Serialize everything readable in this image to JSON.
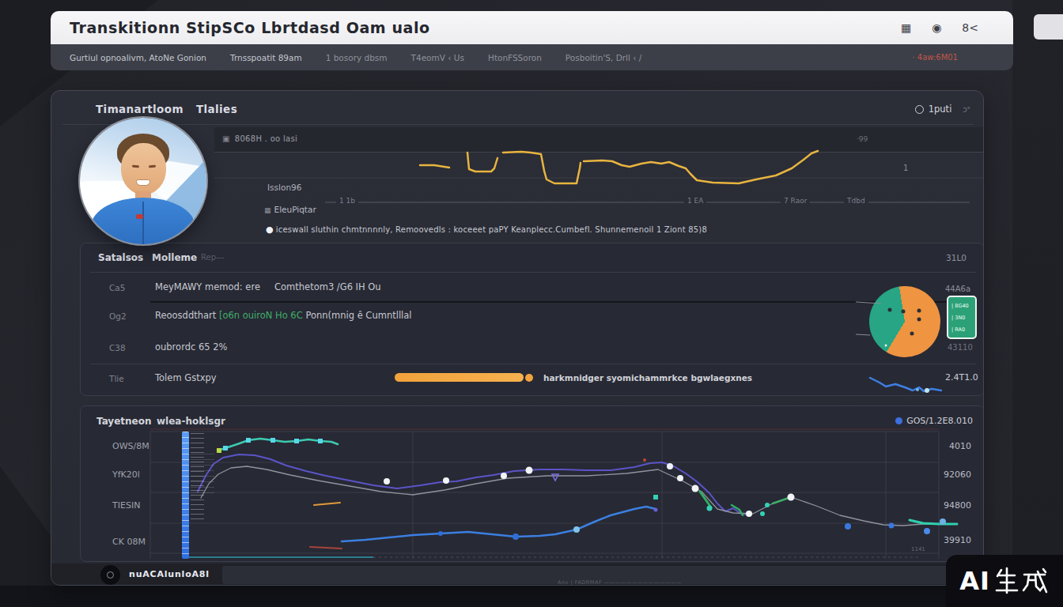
{
  "window": {
    "title": "Transkitionn  StipSCo  Lbrtdasd  Oam ualo",
    "titlebar_icons": [
      "grid-icon",
      "globe-icon",
      "user-icon"
    ],
    "nav": {
      "items": [
        "Gurtiul opnoalivm, AtoNe Gonion",
        "Trnsspoatit 89am",
        "1 bosory dbsm",
        "T4eomV ‹ Us",
        "HtonFSSoron",
        "Posboitin'S, Drll ‹ /"
      ],
      "right_badge": "· 4aw:6M01"
    }
  },
  "panel": {
    "title_word1": "Timanartloom",
    "title_word2": "Tlalies",
    "pub_label": "1puti",
    "pub_extra": "ɔᵊ",
    "meta_label": "8068H . oo lasi",
    "meta_right": "·99",
    "axis_mark": "1",
    "label_primary": "Isslon96",
    "label_secondary": "EleuPiqtar",
    "ticks": [
      "1 1b",
      "1 EA",
      "7 Raor",
      "Tdbd"
    ],
    "note_bullet": "●",
    "note": "iceswall sluthin chmtnnnnly, Remoovedls : koceeet paPY Keanplecc.Cumbefl. Shunnemenoil 1 Ziont 85)8"
  },
  "overview": {
    "col1": "Satalsos",
    "col2": "Molleme",
    "col2_faded": "Rep---",
    "header_value": "31L0",
    "rows": [
      {
        "label": "Ca5",
        "text1": "MeyMAWY memod: ere",
        "text2": "Comthetom3 /G6 IH Ou",
        "value": "44A6a"
      },
      {
        "label": "Og2",
        "text1": "Reoosddthart ",
        "green": "[o6n ouiroN Ho 6C ",
        "text2": "Ponn(mnig ê Cumntlllal"
      },
      {
        "label": "C38",
        "text1": "oubrordc 65 2%"
      },
      {
        "label": "Tlie",
        "text1": "Tolem Gstxpy",
        "note": "harkmnidger syomichammrkce bgwlaegxnes"
      }
    ],
    "legend_lines": [
      "| 8G40",
      "| 3N0",
      "| RA0"
    ],
    "legend_footer": "43110",
    "spark_value": "2.4T1.0"
  },
  "lower": {
    "title_word1": "Tayetneon",
    "title_word2": "wlea-hoklsgr",
    "right_value": "GOS/1.2E8.010",
    "y_labels": [
      "OWS/8M",
      "YfK20l",
      "TIESIN",
      "CK 08M"
    ],
    "right_values": [
      "4010",
      "92060",
      "94800",
      "39910"
    ],
    "corner_note": "1141"
  },
  "footer": {
    "button_label": "nuACAlunloA8l",
    "fineprint": "Anv | FADRMAF ——————————————"
  },
  "watermark": {
    "label": "AI生成",
    "latin": "AI"
  },
  "chart_data": {
    "yellow_spark": {
      "type": "line",
      "series": [
        {
          "color": "#e7b43f",
          "width": 2.5,
          "points": [
            [
              260,
              48
            ],
            [
              278,
              48
            ],
            [
              297,
              51
            ]
          ]
        },
        {
          "color": "#e7b43f",
          "width": 2.5,
          "points": [
            [
              320,
              32
            ],
            [
              322,
              53
            ],
            [
              330,
              56
            ],
            [
              350,
              56
            ],
            [
              354,
              52
            ],
            [
              358,
              39
            ]
          ]
        },
        {
          "color": "#e7b43f",
          "width": 2.5,
          "points": [
            [
              365,
              32
            ],
            [
              388,
              31
            ],
            [
              400,
              32
            ],
            [
              413,
              34
            ],
            [
              417,
              55
            ],
            [
              420,
              66
            ],
            [
              430,
              71
            ],
            [
              458,
              71
            ],
            [
              462,
              52
            ],
            [
              463,
              45
            ]
          ]
        },
        {
          "color": "#e7b43f",
          "width": 2.5,
          "points": [
            [
              467,
              43
            ],
            [
              490,
              42
            ],
            [
              503,
              43
            ],
            [
              515,
              48
            ],
            [
              525,
              50
            ],
            [
              540,
              46
            ],
            [
              552,
              44
            ],
            [
              565,
              46
            ],
            [
              575,
              44
            ],
            [
              587,
              49
            ],
            [
              596,
              52
            ],
            [
              602,
              59
            ],
            [
              610,
              67
            ],
            [
              630,
              70
            ],
            [
              663,
              71
            ],
            [
              685,
              66
            ],
            [
              710,
              61
            ],
            [
              730,
              52
            ],
            [
              745,
              41
            ],
            [
              755,
              33
            ],
            [
              763,
              30
            ]
          ]
        }
      ]
    },
    "pie": {
      "type": "pie",
      "slices": [
        {
          "color": "#27a584",
          "pct": 39
        },
        {
          "color": "#ef9440",
          "pct": 61
        }
      ],
      "teal_deg": [
        211,
        351
      ],
      "dots": [
        [
          1023,
          84,
          2.5,
          "#2c2e35"
        ],
        [
          1040,
          86,
          2.5,
          "#2c2e35"
        ],
        [
          1060,
          85,
          2.5,
          "#2c2e35"
        ],
        [
          1060,
          96,
          2.5,
          "#2c2e35"
        ],
        [
          1051,
          114,
          2.5,
          "#2c2e35"
        ],
        [
          1018,
          129,
          1.5,
          "#e8f4ee"
        ]
      ]
    },
    "blue_spark": {
      "type": "line",
      "series": [
        {
          "color": "#3e7ee2",
          "width": 2.5,
          "points": [
            [
              998,
              170
            ],
            [
              1010,
              176
            ],
            [
              1018,
              181
            ],
            [
              1030,
              178
            ],
            [
              1042,
              182
            ],
            [
              1052,
              186
            ],
            [
              1060,
              182
            ],
            [
              1066,
              187
            ],
            [
              1076,
              184
            ],
            [
              1088,
              186
            ]
          ]
        }
      ],
      "dots": [
        [
          1070,
          186,
          3,
          "#bfe3f2"
        ],
        [
          1058,
          185,
          2,
          "#6fb7e8"
        ]
      ]
    },
    "lower_multi": {
      "type": "line",
      "series": [
        {
          "name": "teal",
          "color": "#3ec9b0",
          "width": 2.5,
          "points": [
            [
              173,
              56
            ],
            [
              183,
              53
            ],
            [
              198,
              48
            ],
            [
              212,
              43
            ],
            [
              227,
              41
            ],
            [
              243,
              43
            ],
            [
              258,
              45
            ],
            [
              273,
              44
            ],
            [
              288,
              42
            ],
            [
              303,
              44
            ],
            [
              317,
              45
            ],
            [
              325,
              48
            ]
          ]
        },
        {
          "name": "purple",
          "color": "#5b54c8",
          "width": 2,
          "points": [
            [
              148,
              108
            ],
            [
              158,
              88
            ],
            [
              168,
              73
            ],
            [
              180,
              65
            ],
            [
              200,
              61
            ],
            [
              220,
              62
            ],
            [
              240,
              67
            ],
            [
              260,
              75
            ],
            [
              285,
              82
            ],
            [
              310,
              88
            ],
            [
              340,
              94
            ],
            [
              370,
              100
            ],
            [
              400,
              104
            ],
            [
              430,
              100
            ],
            [
              455,
              96
            ],
            [
              475,
              95
            ],
            [
              500,
              90
            ],
            [
              522,
              87
            ],
            [
              548,
              82
            ],
            [
              580,
              80
            ],
            [
              610,
              80
            ],
            [
              640,
              81
            ],
            [
              670,
              81
            ],
            [
              700,
              77
            ],
            [
              720,
              72
            ],
            [
              735,
              71
            ],
            [
              750,
              76
            ],
            [
              765,
              85
            ],
            [
              780,
              96
            ],
            [
              795,
              110
            ],
            [
              805,
              123
            ],
            [
              815,
              133
            ],
            [
              825,
              129
            ],
            [
              835,
              136
            ],
            [
              845,
              137
            ]
          ]
        },
        {
          "name": "gray",
          "color": "#8f949e",
          "width": 1.3,
          "points": [
            [
              152,
              116
            ],
            [
              162,
              98
            ],
            [
              174,
              86
            ],
            [
              190,
              78
            ],
            [
              210,
              76
            ],
            [
              235,
              80
            ],
            [
              265,
              87
            ],
            [
              300,
              94
            ],
            [
              340,
              101
            ],
            [
              380,
              108
            ],
            [
              420,
              112
            ],
            [
              460,
              106
            ],
            [
              500,
              98
            ],
            [
              540,
              91
            ],
            [
              590,
              88
            ],
            [
              640,
              88
            ],
            [
              690,
              85
            ],
            [
              730,
              80
            ],
            [
              760,
              94
            ],
            [
              785,
              108
            ],
            [
              805,
              130
            ],
            [
              825,
              135
            ],
            [
              850,
              136
            ],
            [
              875,
              123
            ],
            [
              898,
              115
            ],
            [
              930,
              126
            ],
            [
              960,
              138
            ],
            [
              990,
              145
            ],
            [
              1015,
              150
            ],
            [
              1040,
              151
            ],
            [
              1065,
              149
            ],
            [
              1085,
              149
            ]
          ]
        },
        {
          "name": "blue",
          "color": "#3b7fe0",
          "width": 2.5,
          "points": [
            [
              330,
              171
            ],
            [
              360,
              169
            ],
            [
              390,
              166
            ],
            [
              420,
              163
            ],
            [
              455,
              161
            ],
            [
              490,
              159
            ],
            [
              520,
              162
            ],
            [
              550,
              165
            ],
            [
              580,
              164
            ],
            [
              600,
              162
            ],
            [
              627,
              156
            ],
            [
              650,
              146
            ],
            [
              670,
              138
            ],
            [
              700,
              130
            ],
            [
              715,
              127
            ],
            [
              727,
              130
            ]
          ]
        },
        {
          "name": "teal-end",
          "color": "#2fd0b0",
          "width": 3,
          "points": [
            [
              1048,
              144
            ],
            [
              1065,
              148
            ],
            [
              1085,
              149
            ],
            [
              1108,
              149
            ]
          ]
        },
        {
          "name": "green-a",
          "color": "#2fae62",
          "width": 3,
          "points": [
            [
              783,
              108
            ],
            [
              797,
              128
            ]
          ]
        },
        {
          "name": "green-b",
          "color": "#2fae62",
          "width": 2.5,
          "points": [
            [
              823,
              125
            ],
            [
              833,
              131
            ],
            [
              837,
              138
            ]
          ]
        },
        {
          "name": "green-c",
          "color": "#3fae6a",
          "width": 2.5,
          "points": [
            [
              875,
              123
            ],
            [
              898,
              115
            ]
          ]
        },
        {
          "name": "orange",
          "color": "#e09a3a",
          "width": 2,
          "points": [
            [
              295,
              125
            ],
            [
              328,
              122
            ]
          ]
        },
        {
          "name": "red",
          "color": "#a5443c",
          "width": 2,
          "points": [
            [
              290,
              178
            ],
            [
              330,
              180
            ]
          ]
        }
      ],
      "dots": [
        [
          387,
          95,
          4,
          "#f2f4f8"
        ],
        [
          462,
          94,
          4,
          "#f2f4f8"
        ],
        [
          535,
          88,
          4,
          "#f2f4f8"
        ],
        [
          567,
          81,
          4.5,
          "#f4f6fa"
        ],
        [
          745,
          76,
          4,
          "#eef1f6"
        ],
        [
          758,
          91,
          4,
          "#f2f4f8"
        ],
        [
          777,
          104,
          4.5,
          "#f2f4f8"
        ],
        [
          898,
          115,
          4.5,
          "#f2f4f8"
        ],
        [
          845,
          136,
          4,
          "#f2f4f8"
        ],
        [
          795,
          129,
          3.5,
          "#35d0b5"
        ],
        [
          862,
          136,
          3,
          "#35d0b5"
        ],
        [
          868,
          125,
          3,
          "#35d0b5"
        ],
        [
          627,
          156,
          4,
          "#7fc3ea"
        ],
        [
          550,
          165,
          4,
          "#2f6fd8"
        ],
        [
          455,
          161,
          3,
          "#2f6fd8"
        ],
        [
          970,
          152,
          4,
          "#3a78e0"
        ],
        [
          1025,
          151,
          3.5,
          "#3a78e0"
        ],
        [
          1070,
          158,
          4,
          "#4a8ae8"
        ],
        [
          1090,
          146,
          4,
          "#6fb0e8"
        ],
        [
          727,
          131,
          2.5,
          "#6a5fd8"
        ],
        [
          713,
          68,
          2,
          "#c24438"
        ],
        [
          727,
          115,
          3,
          "#35d0b5",
          "s"
        ],
        [
          183,
          53,
          3,
          "#57d8e8",
          "s"
        ],
        [
          212,
          43,
          3,
          "#57d8e8",
          "s"
        ],
        [
          243,
          43,
          3,
          "#57d8e8",
          "s"
        ],
        [
          273,
          44,
          3,
          "#57d8e8",
          "s"
        ],
        [
          303,
          44,
          3,
          "#57d8e8",
          "s"
        ],
        [
          175,
          56,
          3,
          "#b8d848",
          "s"
        ],
        [
          600,
          90,
          4,
          "#7a6fe0",
          "t"
        ]
      ]
    }
  }
}
